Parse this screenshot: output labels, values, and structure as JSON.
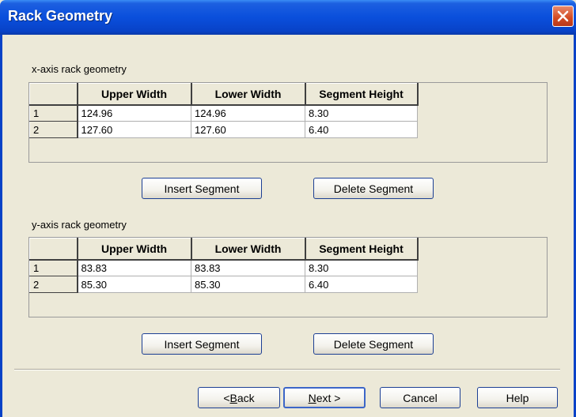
{
  "window": {
    "title": "Rack Geometry"
  },
  "x_section": {
    "label": "x-axis rack geometry",
    "headers": [
      "Upper Width",
      "Lower Width",
      "Segment Height"
    ],
    "rows": [
      {
        "index": "1",
        "upper": "124.96",
        "lower": "124.96",
        "height": "8.30"
      },
      {
        "index": "2",
        "upper": "127.60",
        "lower": "127.60",
        "height": "6.40"
      }
    ],
    "insert_label": "Insert Segment",
    "delete_label": "Delete Segment"
  },
  "y_section": {
    "label": "y-axis rack geometry",
    "headers": [
      "Upper Width",
      "Lower Width",
      "Segment Height"
    ],
    "rows": [
      {
        "index": "1",
        "upper": "83.83",
        "lower": "83.83",
        "height": "8.30"
      },
      {
        "index": "2",
        "upper": "85.30",
        "lower": "85.30",
        "height": "6.40"
      }
    ],
    "insert_label": "Insert Segment",
    "delete_label": "Delete Segment"
  },
  "footer": {
    "back_prefix": "< ",
    "back_mnemonic": "B",
    "back_rest": "ack",
    "next_mnemonic": "N",
    "next_rest": "ext >",
    "cancel_label": "Cancel",
    "help_label": "Help"
  },
  "colors": {
    "titlebar": "#0a4fdc",
    "close": "#d24a22",
    "face": "#ece9d8"
  }
}
